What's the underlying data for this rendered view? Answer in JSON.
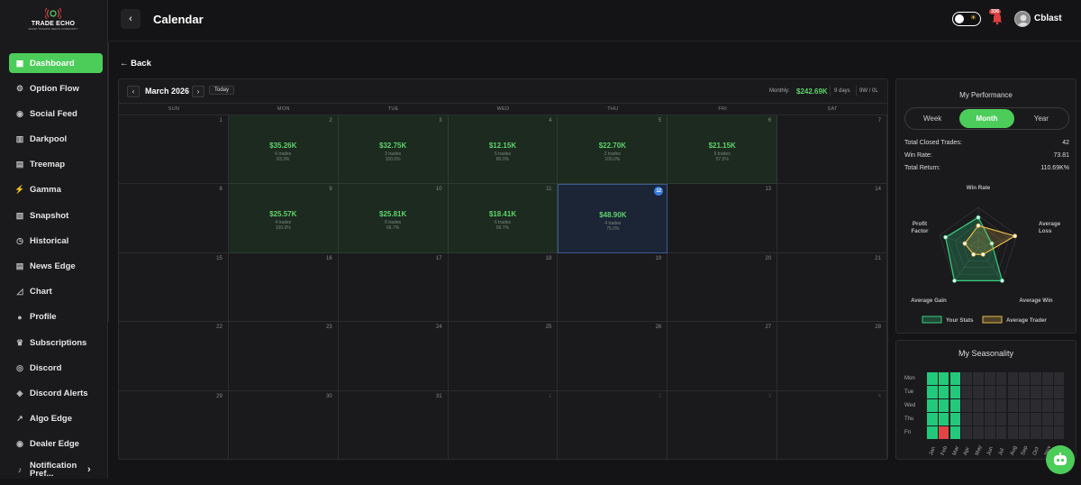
{
  "brand": {
    "name": "TRADE ECHO",
    "tagline": "SMART TRADING MEETS COMMUNITY"
  },
  "sidebar": {
    "items": [
      {
        "label": "Dashboard",
        "icon": "grid-icon",
        "active": true
      },
      {
        "label": "Option Flow",
        "icon": "flow-icon"
      },
      {
        "label": "Social Feed",
        "icon": "rss-icon"
      },
      {
        "label": "Darkpool",
        "icon": "bars-icon"
      },
      {
        "label": "Treemap",
        "icon": "chart-icon"
      },
      {
        "label": "Gamma",
        "icon": "bolt-icon"
      },
      {
        "label": "Snapshot",
        "icon": "snapshot-icon"
      },
      {
        "label": "Historical",
        "icon": "history-icon"
      },
      {
        "label": "News Edge",
        "icon": "news-icon"
      },
      {
        "label": "Chart",
        "icon": "line-chart-icon"
      },
      {
        "label": "Profile",
        "icon": "user-icon"
      },
      {
        "label": "Subscriptions",
        "icon": "crown-icon"
      },
      {
        "label": "Discord",
        "icon": "discord-icon"
      },
      {
        "label": "Discord Alerts",
        "icon": "discord-alert-icon"
      },
      {
        "label": "Algo Edge",
        "icon": "trend-icon"
      },
      {
        "label": "Dealer Edge",
        "icon": "dealer-icon"
      },
      {
        "label": "Notification Pref...",
        "icon": "bell-settings-icon"
      }
    ]
  },
  "topbar": {
    "title": "Calendar",
    "notification_count": "336",
    "username": "Cblast"
  },
  "back_label": "← Back",
  "calendar": {
    "month": "March 2026",
    "today_label": "Today",
    "monthly_label": "Monthly:",
    "monthly_value": "$242.69K",
    "days": "9 days",
    "wl": "9W / 0L",
    "dow": [
      "SUN",
      "MON",
      "TUE",
      "WED",
      "THU",
      "FRI",
      "SAT"
    ],
    "weeks": [
      [
        {
          "day": "1"
        },
        {
          "day": "2",
          "pnl": "$35.26K",
          "trades": "6 trades",
          "wr": "83.3%"
        },
        {
          "day": "3",
          "pnl": "$32.75K",
          "trades": "3 trades",
          "wr": "100.0%"
        },
        {
          "day": "4",
          "pnl": "$12.15K",
          "trades": "5 trades",
          "wr": "80.0%"
        },
        {
          "day": "5",
          "pnl": "$22.70K",
          "trades": "2 trades",
          "wr": "100.0%"
        },
        {
          "day": "6",
          "pnl": "$21.15K",
          "trades": "5 trades",
          "wr": "57.5%"
        },
        {
          "day": "7"
        }
      ],
      [
        {
          "day": "8"
        },
        {
          "day": "9",
          "pnl": "$25.57K",
          "trades": "4 trades",
          "wr": "100.0%"
        },
        {
          "day": "10",
          "pnl": "$25.81K",
          "trades": "6 trades",
          "wr": "66.7%"
        },
        {
          "day": "11",
          "pnl": "$18.41K",
          "trades": "6 trades",
          "wr": "66.7%"
        },
        {
          "day": "12",
          "pnl": "$48.90K",
          "trades": "4 trades",
          "wr": "75.0%",
          "today": true
        },
        {
          "day": "13"
        },
        {
          "day": "14"
        }
      ],
      [
        {
          "day": "15"
        },
        {
          "day": "16"
        },
        {
          "day": "17"
        },
        {
          "day": "18"
        },
        {
          "day": "19"
        },
        {
          "day": "20"
        },
        {
          "day": "21"
        }
      ],
      [
        {
          "day": "22"
        },
        {
          "day": "23"
        },
        {
          "day": "24"
        },
        {
          "day": "25"
        },
        {
          "day": "26"
        },
        {
          "day": "27"
        },
        {
          "day": "28"
        }
      ],
      [
        {
          "day": "29"
        },
        {
          "day": "30"
        },
        {
          "day": "31"
        },
        {
          "day": "1",
          "out": true
        },
        {
          "day": "2",
          "out": true
        },
        {
          "day": "3",
          "out": true
        },
        {
          "day": "4",
          "out": true
        }
      ]
    ]
  },
  "performance": {
    "title": "My Performance",
    "tabs": [
      "Week",
      "Month",
      "Year"
    ],
    "active_tab": "Month",
    "stats": [
      {
        "label": "Total Closed Trades:",
        "value": "42"
      },
      {
        "label": "Win Rate:",
        "value": "73.81"
      },
      {
        "label": "Total Return:",
        "value": "110.69K%"
      }
    ],
    "radar": {
      "axes": [
        "Win Rate",
        "Average Loss",
        "Average Win",
        "Average Gain",
        "Profit Factor"
      ],
      "your_stats": [
        0.75,
        0.35,
        1.0,
        1.0,
        0.85
      ],
      "average_trader": [
        0.55,
        0.95,
        0.2,
        0.2,
        0.35
      ],
      "legend": [
        "Your Stats",
        "Average Trader"
      ],
      "colors": {
        "your": "#35d07f",
        "average": "#e8b84a"
      }
    }
  },
  "seasonality": {
    "title": "My Seasonality",
    "days": [
      "Mon",
      "Tue",
      "Wed",
      "Thu",
      "Fri"
    ],
    "months": [
      "Jan",
      "Feb",
      "Mar",
      "Apr",
      "May",
      "Jun",
      "Jul",
      "Aug",
      "Sep",
      "Oct",
      "Nov",
      "Dec"
    ],
    "cells": [
      [
        "g",
        "g",
        "g",
        "n",
        "n",
        "n",
        "n",
        "n",
        "n",
        "n",
        "n",
        "n"
      ],
      [
        "g",
        "g",
        "g",
        "n",
        "n",
        "n",
        "n",
        "n",
        "n",
        "n",
        "n",
        "n"
      ],
      [
        "g",
        "g",
        "g",
        "n",
        "n",
        "n",
        "n",
        "n",
        "n",
        "n",
        "n",
        "n"
      ],
      [
        "g",
        "g",
        "g",
        "n",
        "n",
        "n",
        "n",
        "n",
        "n",
        "n",
        "n",
        "n"
      ],
      [
        "g",
        "r",
        "g",
        "n",
        "n",
        "n",
        "n",
        "n",
        "n",
        "n",
        "n",
        "n"
      ]
    ],
    "colors": {
      "g": "#23c97a",
      "r": "#e04545",
      "n": "#2c2c30"
    }
  }
}
